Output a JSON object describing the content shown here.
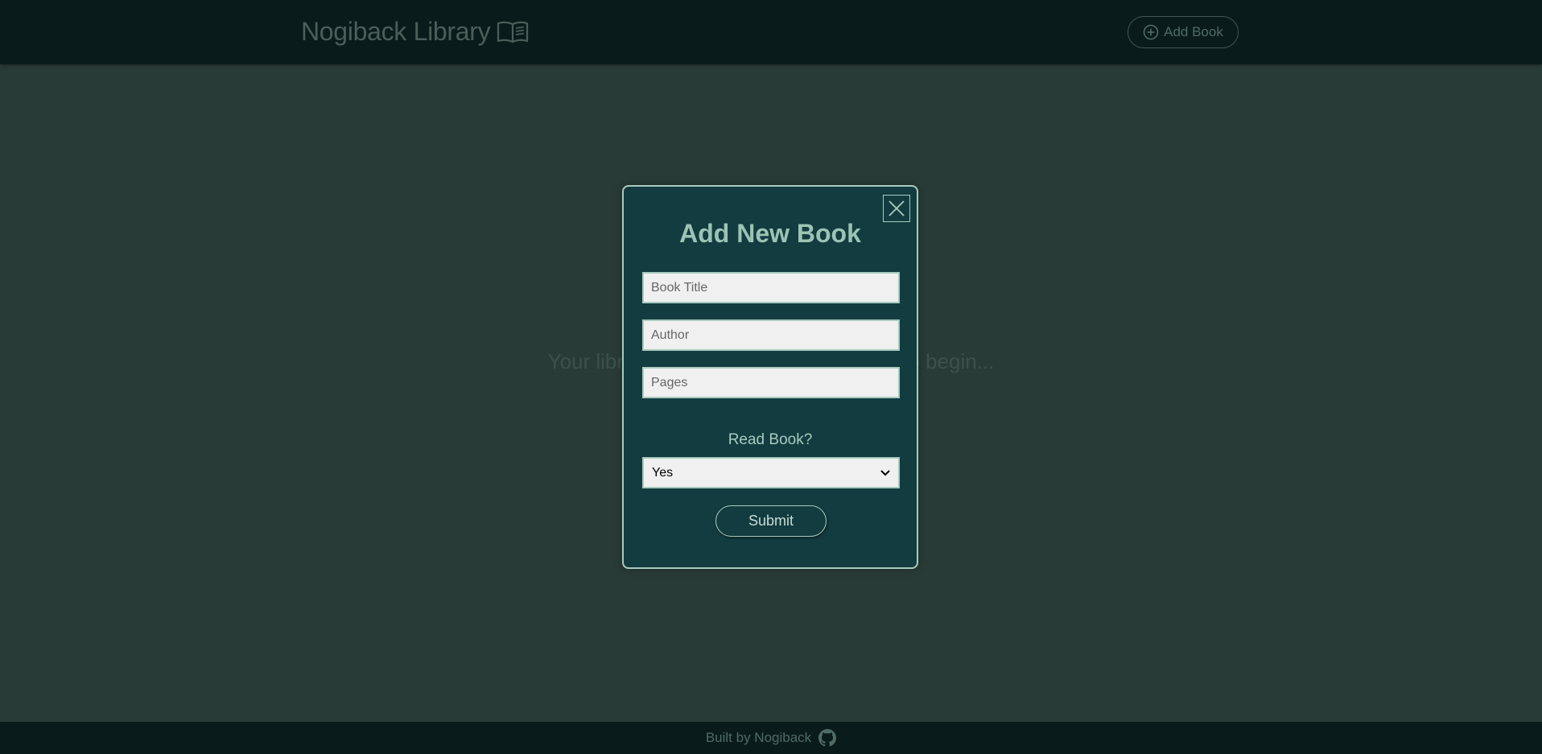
{
  "header": {
    "logo_text": "Nogiback Library",
    "logo_icon": "open-book-icon",
    "add_book_label": "Add Book",
    "add_book_icon": "plus-circle-icon"
  },
  "main": {
    "empty_message": "Your library is empty. Click 'Add Book' to begin..."
  },
  "modal": {
    "title": "Add New Book",
    "close_icon": "close-icon",
    "fields": {
      "title_placeholder": "Book Title",
      "title_value": "",
      "author_placeholder": "Author",
      "author_value": "",
      "pages_placeholder": "Pages",
      "pages_value": ""
    },
    "read_label": "Read Book?",
    "read_selected": "Yes",
    "submit_label": "Submit"
  },
  "footer": {
    "text": "Built by Nogiback",
    "icon": "github-icon"
  },
  "colors": {
    "page_bg": "#293b36",
    "header_bg": "#0a1b1b",
    "modal_bg": "#123c40",
    "modal_border": "#a9cbbf",
    "accent_text": "#9cc3b4"
  }
}
